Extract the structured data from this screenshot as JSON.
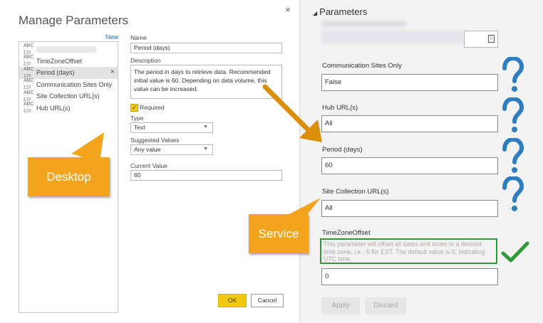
{
  "desktop": {
    "title": "Manage Parameters",
    "new_link": "New",
    "params": [
      {
        "label": "",
        "blurred": true
      },
      {
        "label": "TimeZoneOffset"
      },
      {
        "label": "Period (days)",
        "selected": true
      },
      {
        "label": "Communication Sites Only"
      },
      {
        "label": "Site Collection URL(s)"
      },
      {
        "label": "Hub URL(s)"
      }
    ],
    "abc_icon": "ABC",
    "abc_sub": "123",
    "name_label": "Name",
    "name_value": "Period (days)",
    "description_label": "Description",
    "description_value": "The period in days to retrieve data. Recommended initial value is 60. Depending on data volume, this value can be increased.",
    "required_label": "Required",
    "required_checked": true,
    "type_label": "Type",
    "type_value": "Text",
    "suggested_label": "Suggested Values",
    "suggested_value": "Any value",
    "current_label": "Current Value",
    "current_value": "60",
    "ok_label": "OK",
    "cancel_label": "Cancel",
    "close_icon": "×"
  },
  "service": {
    "title": "Parameters",
    "fields": [
      {
        "label": "Communication Sites Only",
        "value": "False"
      },
      {
        "label": "Hub URL(s)",
        "value": "All"
      },
      {
        "label": "Period (days)",
        "value": "60"
      },
      {
        "label": "Site Collection URL(s)",
        "value": "All"
      },
      {
        "label": "TimeZoneOffset",
        "value": "0"
      }
    ],
    "timezone_description": "This parameter will offset all dates and times to a desired time zone, i.e. -5 for EST. The default value is 0, indicating UTC time.",
    "apply_label": "Apply",
    "discard_label": "Discard"
  },
  "callouts": {
    "desktop": "Desktop",
    "service": "Service"
  },
  "colors": {
    "callout": "#f2a51c",
    "question": "#2f7dc1",
    "check": "#2e9a3a",
    "accent_yellow": "#f2c811"
  }
}
